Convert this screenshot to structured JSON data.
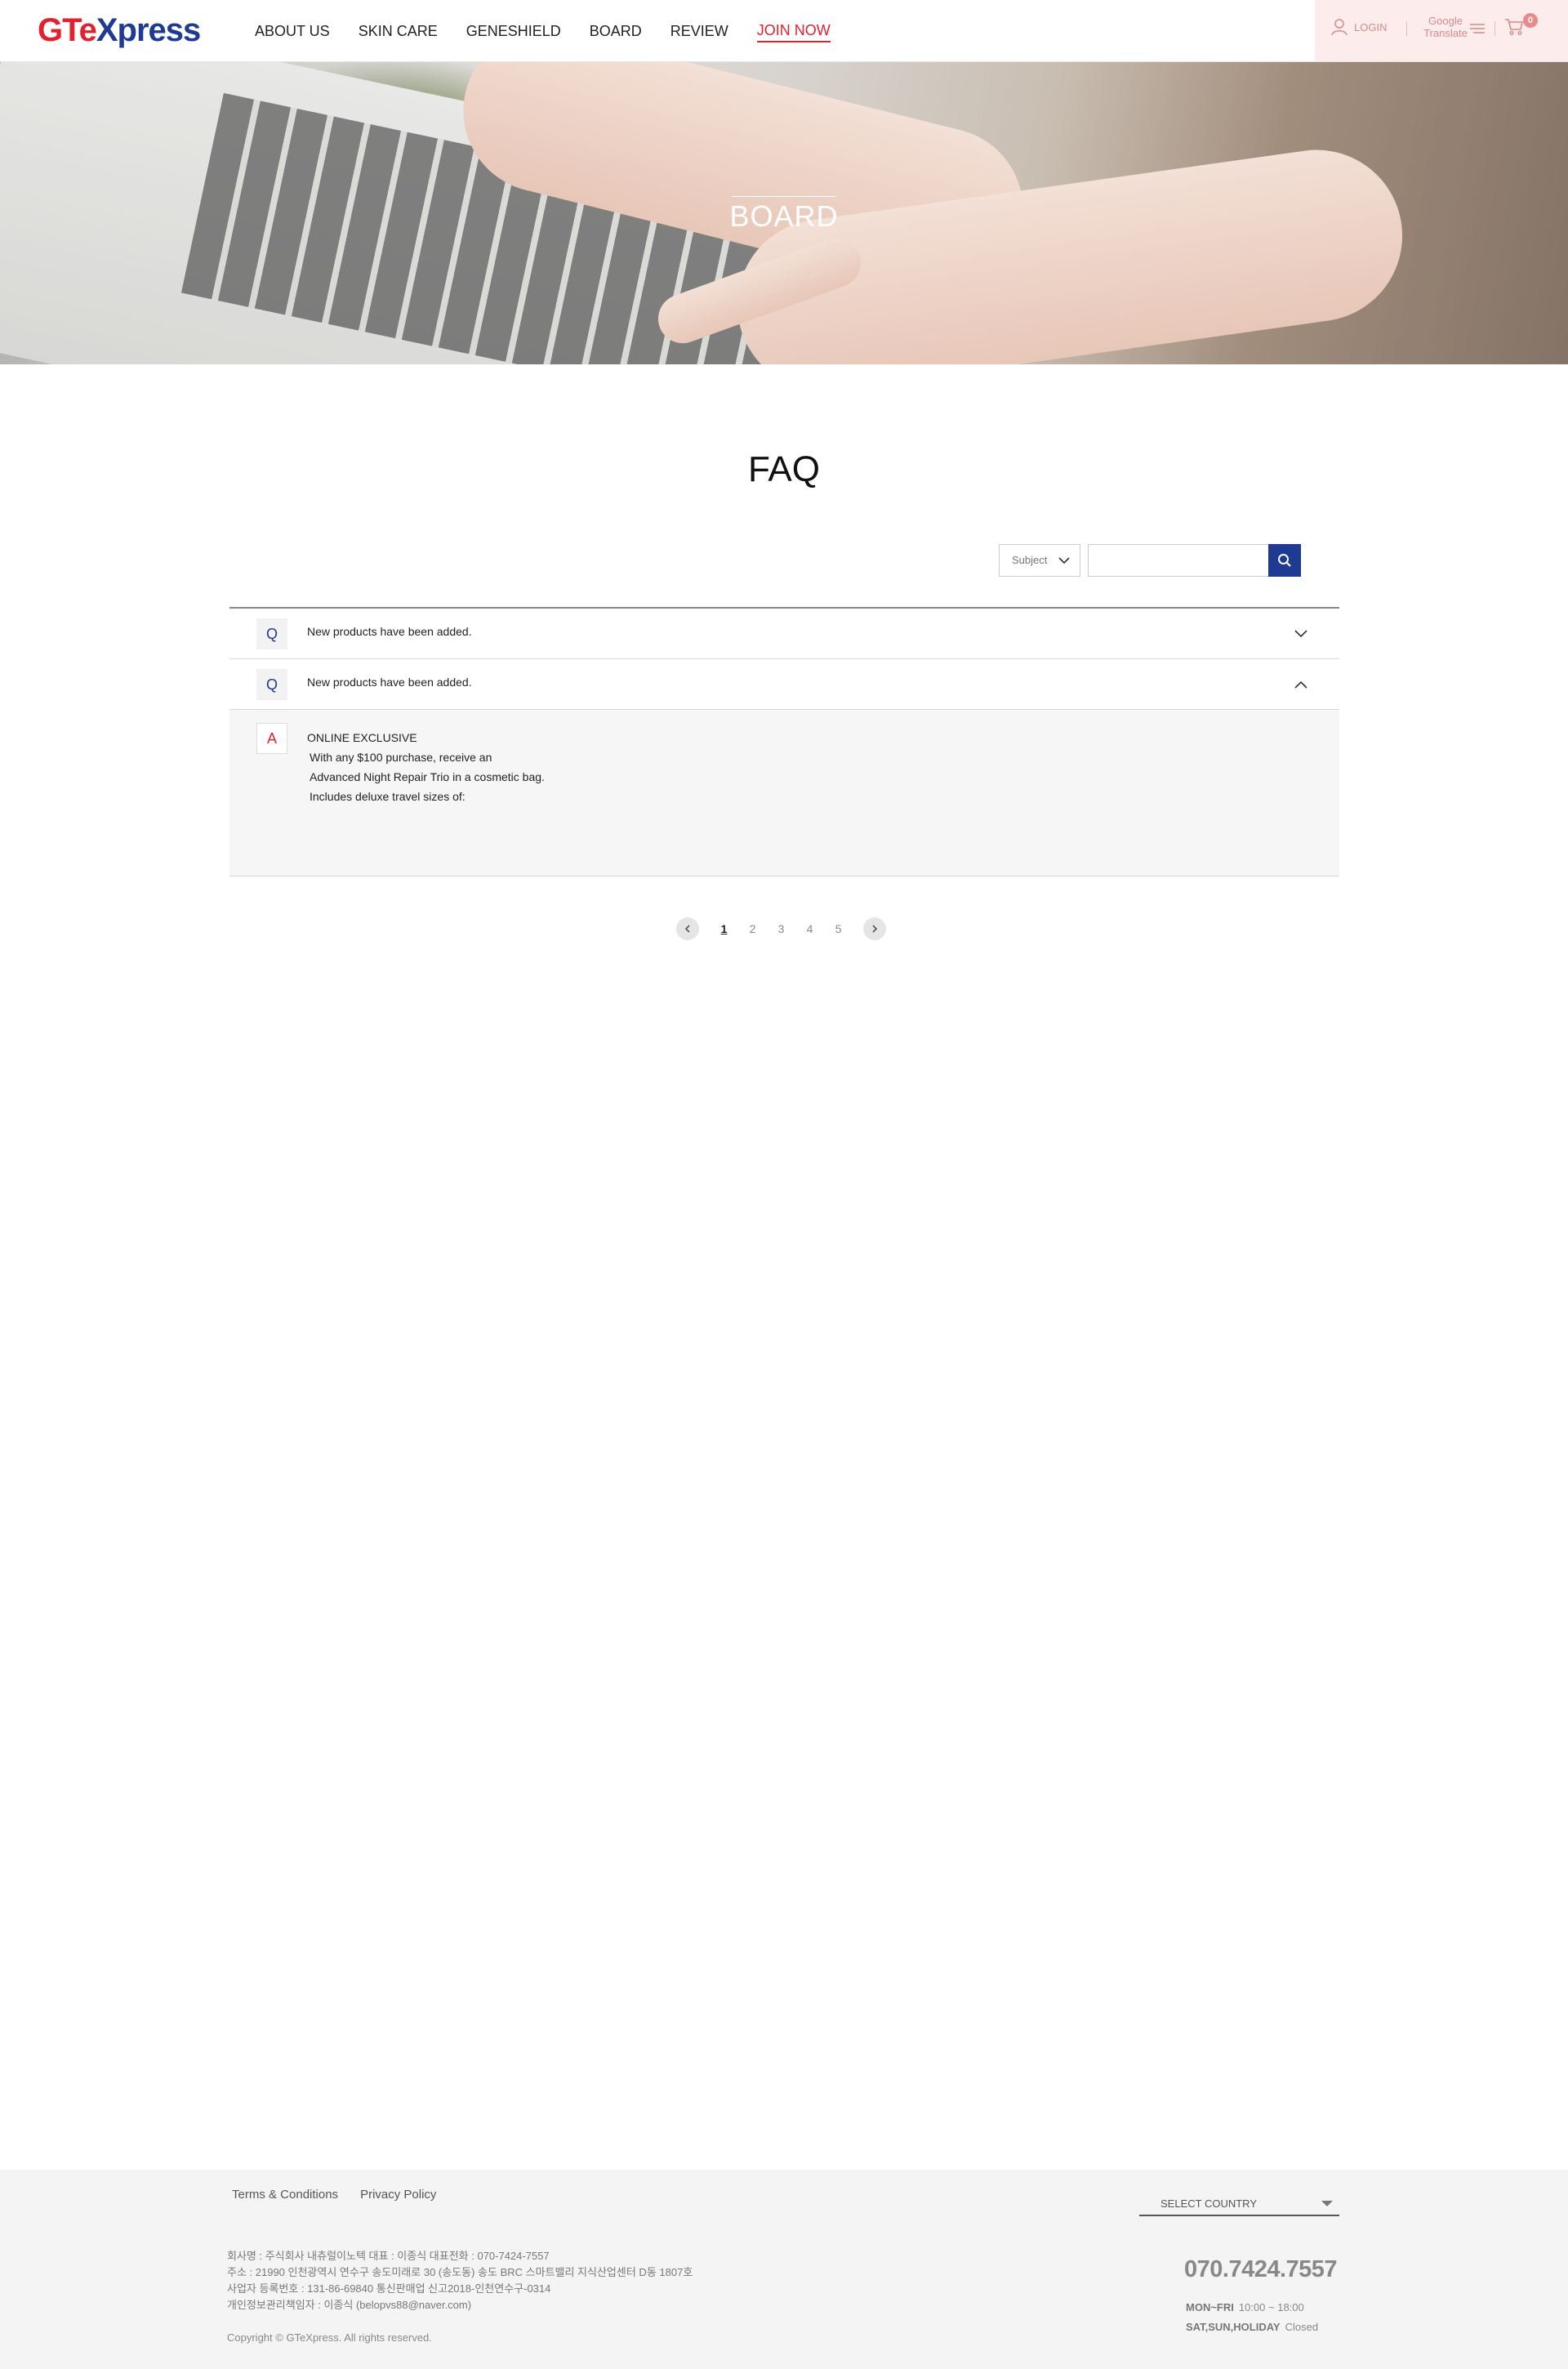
{
  "header": {
    "logo_part1": "GTe",
    "logo_part2": "Xpress",
    "nav": [
      "ABOUT US",
      "SKIN CARE",
      "GENESHIELD",
      "BOARD",
      "REVIEW",
      "JOIN NOW"
    ],
    "login_label": "LOGIN",
    "translate_line1": "Google",
    "translate_line2": "Translate",
    "cart_count": "0"
  },
  "hero": {
    "title": "BOARD"
  },
  "faq": {
    "title": "FAQ",
    "search": {
      "select_value": "Subject",
      "input_value": ""
    },
    "items": [
      {
        "q": "Q",
        "question": "New products have been added.",
        "expanded": false
      },
      {
        "q": "Q",
        "question": "New products have been added.",
        "expanded": true
      }
    ],
    "answer": {
      "a": "A",
      "lines": [
        "ONLINE EXCLUSIVE",
        "With any $100 purchase, receive an",
        "Advanced Night Repair Trio in a cosmetic bag.",
        "Includes deluxe travel sizes of:"
      ]
    },
    "pagination": {
      "pages": [
        "1",
        "2",
        "3",
        "4",
        "5"
      ],
      "current": "1"
    }
  },
  "footer": {
    "links": [
      "Terms & Conditions",
      "Privacy Policy"
    ],
    "country_select": "SELECT COUNTRY",
    "info_lines": [
      "회사명 : 주식회사 내츄럴이노텍    대표 : 이종식    대표전화 : 070-7424-7557",
      "주소 : 21990 인천광역시 연수구 송도미래로 30 (송도동) 송도 BRC 스마트밸리 지식산업센터 D동 1807호",
      "사업자 등록번호 : 131-86-69840 통신판매업 신고2018-인천연수구-0314",
      "개인정보관리책임자 : 이종식 (belopvs88@naver.com)"
    ],
    "copyright": "Copyright © GTeXpress. All rights reserved.",
    "phone": "070.7424.7557",
    "hours": [
      {
        "label": "MON~FRI",
        "value": "10:00 ~ 18:00"
      },
      {
        "label": "SAT,SUN,HOLIDAY",
        "value": "Closed"
      }
    ]
  },
  "colors": {
    "brand_red": "#e3202d",
    "brand_blue": "#1f3a93",
    "util_bg": "#fdecec"
  }
}
